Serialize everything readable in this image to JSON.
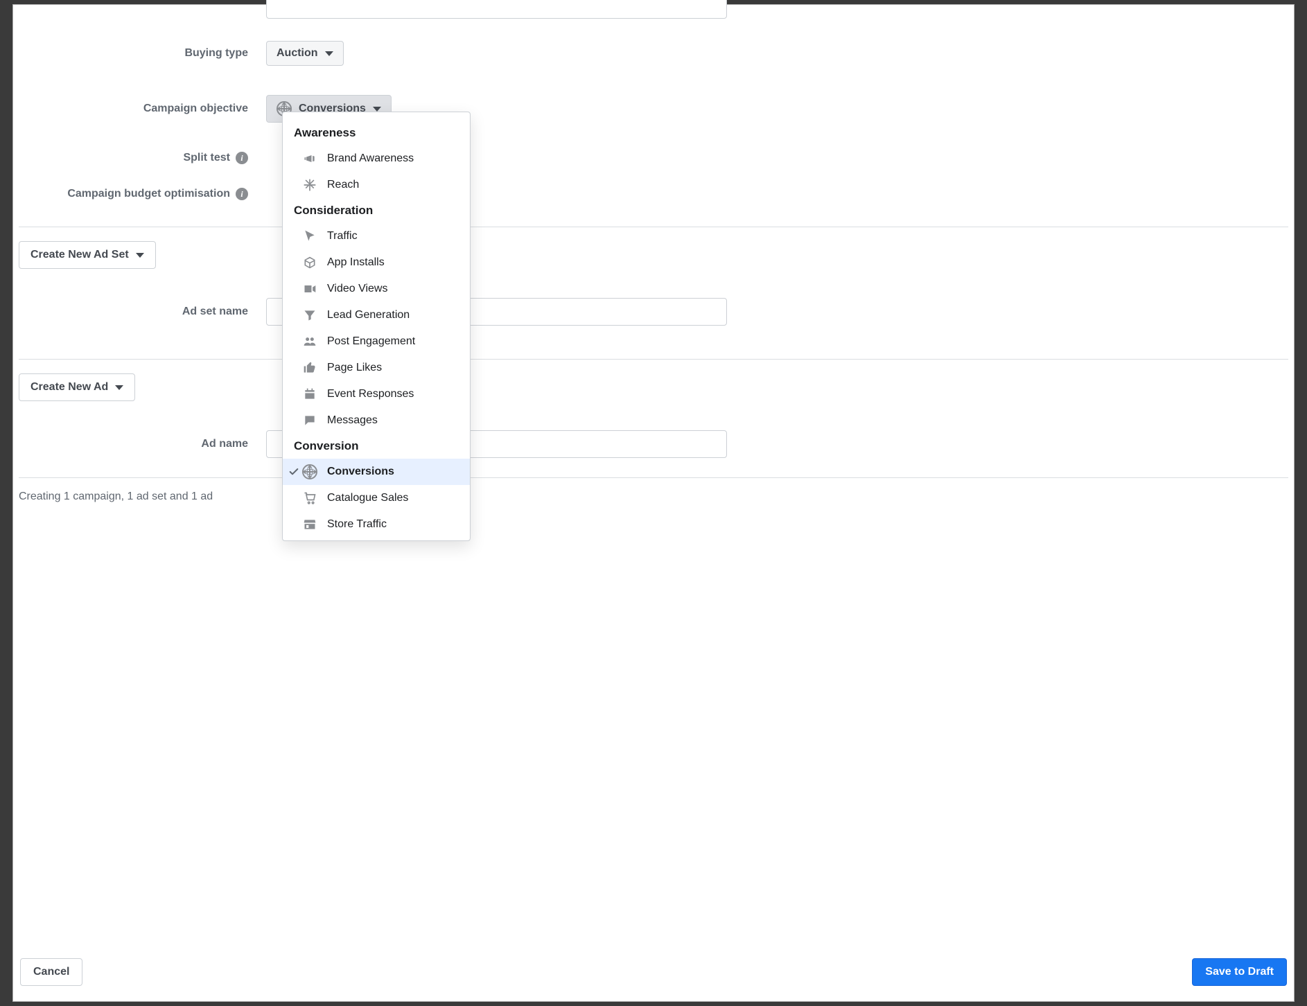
{
  "form": {
    "buying_type_label": "Buying type",
    "buying_type_value": "Auction",
    "campaign_objective_label": "Campaign objective",
    "campaign_objective_value": "Conversions",
    "split_test_label": "Split test",
    "budget_opt_label": "Campaign budget optimisation",
    "ad_set_name_label": "Ad set name",
    "ad_name_label": "Ad name",
    "create_new_ad_set": "Create New Ad Set",
    "create_new_ad": "Create New Ad",
    "creating_text": "Creating 1 campaign, 1 ad set and 1 ad"
  },
  "objective_menu": {
    "groups": [
      {
        "title": "Awareness",
        "items": [
          {
            "label": "Brand Awareness",
            "icon": "megaphone"
          },
          {
            "label": "Reach",
            "icon": "snowflake"
          }
        ]
      },
      {
        "title": "Consideration",
        "items": [
          {
            "label": "Traffic",
            "icon": "cursor"
          },
          {
            "label": "App Installs",
            "icon": "box"
          },
          {
            "label": "Video Views",
            "icon": "video"
          },
          {
            "label": "Lead Generation",
            "icon": "funnel"
          },
          {
            "label": "Post Engagement",
            "icon": "people"
          },
          {
            "label": "Page Likes",
            "icon": "thumb"
          },
          {
            "label": "Event Responses",
            "icon": "calendar"
          },
          {
            "label": "Messages",
            "icon": "chat"
          }
        ]
      },
      {
        "title": "Conversion",
        "items": [
          {
            "label": "Conversions",
            "icon": "globe",
            "selected": true
          },
          {
            "label": "Catalogue Sales",
            "icon": "cart"
          },
          {
            "label": "Store Traffic",
            "icon": "store"
          }
        ]
      }
    ]
  },
  "footer": {
    "cancel": "Cancel",
    "save": "Save to Draft"
  }
}
